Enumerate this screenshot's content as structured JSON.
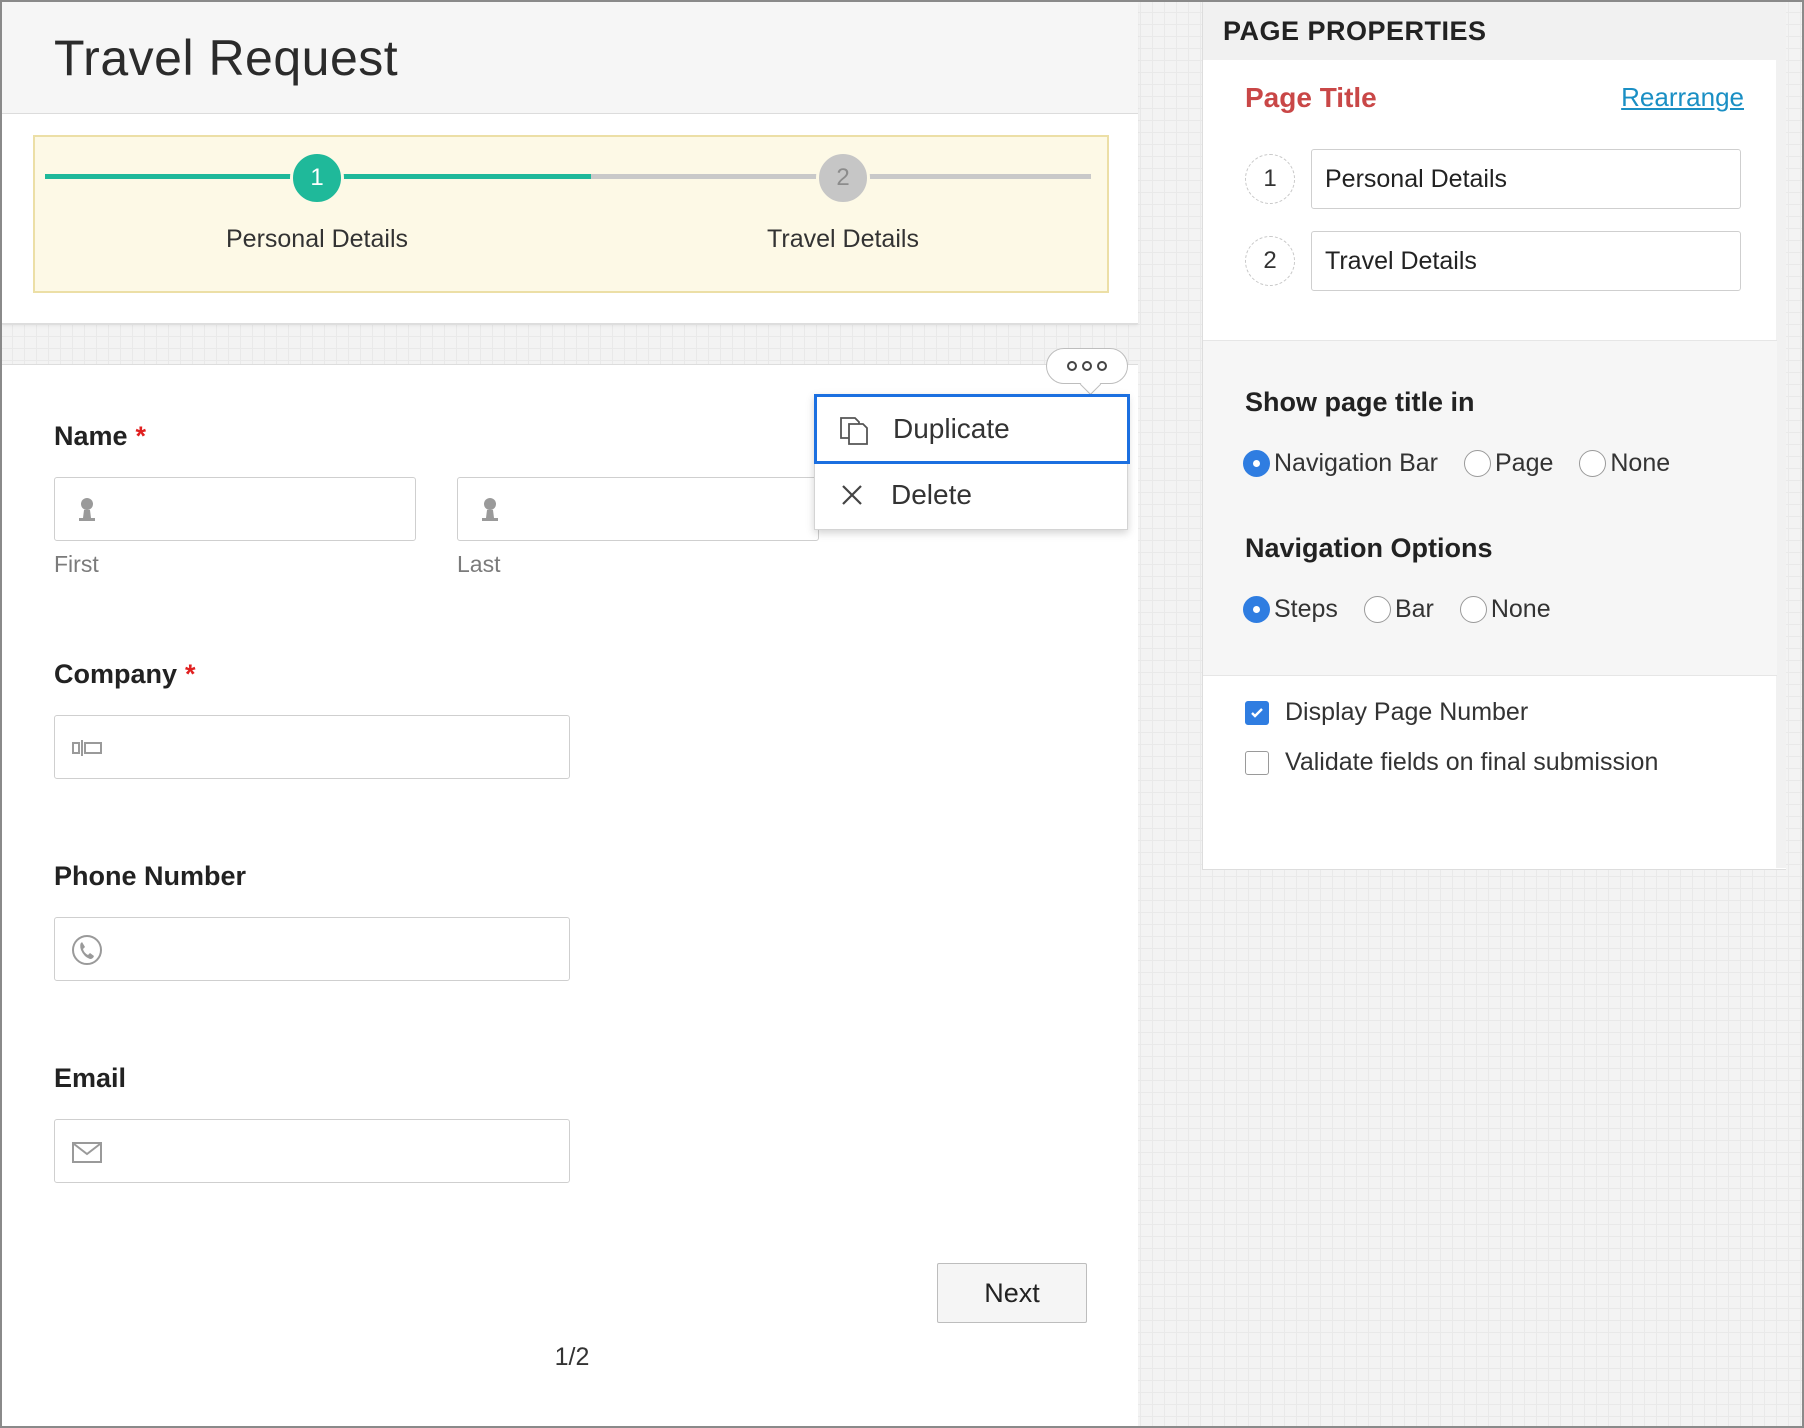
{
  "form": {
    "title": "Travel Request",
    "steps": [
      {
        "number": "1",
        "label": "Personal Details",
        "state": "active"
      },
      {
        "number": "2",
        "label": "Travel Details",
        "state": "inactive"
      }
    ],
    "fields": {
      "name": {
        "label": "Name",
        "required_mark": "*",
        "first_sublabel": "First",
        "last_sublabel": "Last",
        "icon": "user-icon"
      },
      "company": {
        "label": "Company",
        "required_mark": "*",
        "icon": "text-input-icon"
      },
      "phone": {
        "label": "Phone Number",
        "icon": "phone-icon"
      },
      "email": {
        "label": "Email",
        "icon": "envelope-icon"
      }
    },
    "next_label": "Next",
    "page_indicator": "1/2"
  },
  "field_menu": {
    "items": [
      {
        "label": "Duplicate",
        "icon": "duplicate-icon",
        "highlighted": true
      },
      {
        "label": "Delete",
        "icon": "close-icon",
        "highlighted": false
      }
    ]
  },
  "properties": {
    "header": "PAGE PROPERTIES",
    "page_title_label": "Page Title",
    "rearrange_label": "Rearrange",
    "pages": [
      {
        "number": "1",
        "title": "Personal Details"
      },
      {
        "number": "2",
        "title": "Travel Details"
      }
    ],
    "show_title": {
      "label": "Show page title in",
      "options": [
        "Navigation Bar",
        "Page",
        "None"
      ],
      "selected": "Navigation Bar"
    },
    "navigation": {
      "label": "Navigation Options",
      "options": [
        "Steps",
        "Bar",
        "None"
      ],
      "selected": "Steps"
    },
    "checkboxes": [
      {
        "label": "Display Page Number",
        "checked": true
      },
      {
        "label": "Validate fields on final submission",
        "checked": false
      }
    ]
  },
  "colors": {
    "step_active": "#1fb99a",
    "step_inactive": "#c6c6c6",
    "accent_blue": "#2f7de1",
    "page_title_red": "#c94747",
    "link": "#1a8fc4",
    "required": "#e02020"
  }
}
